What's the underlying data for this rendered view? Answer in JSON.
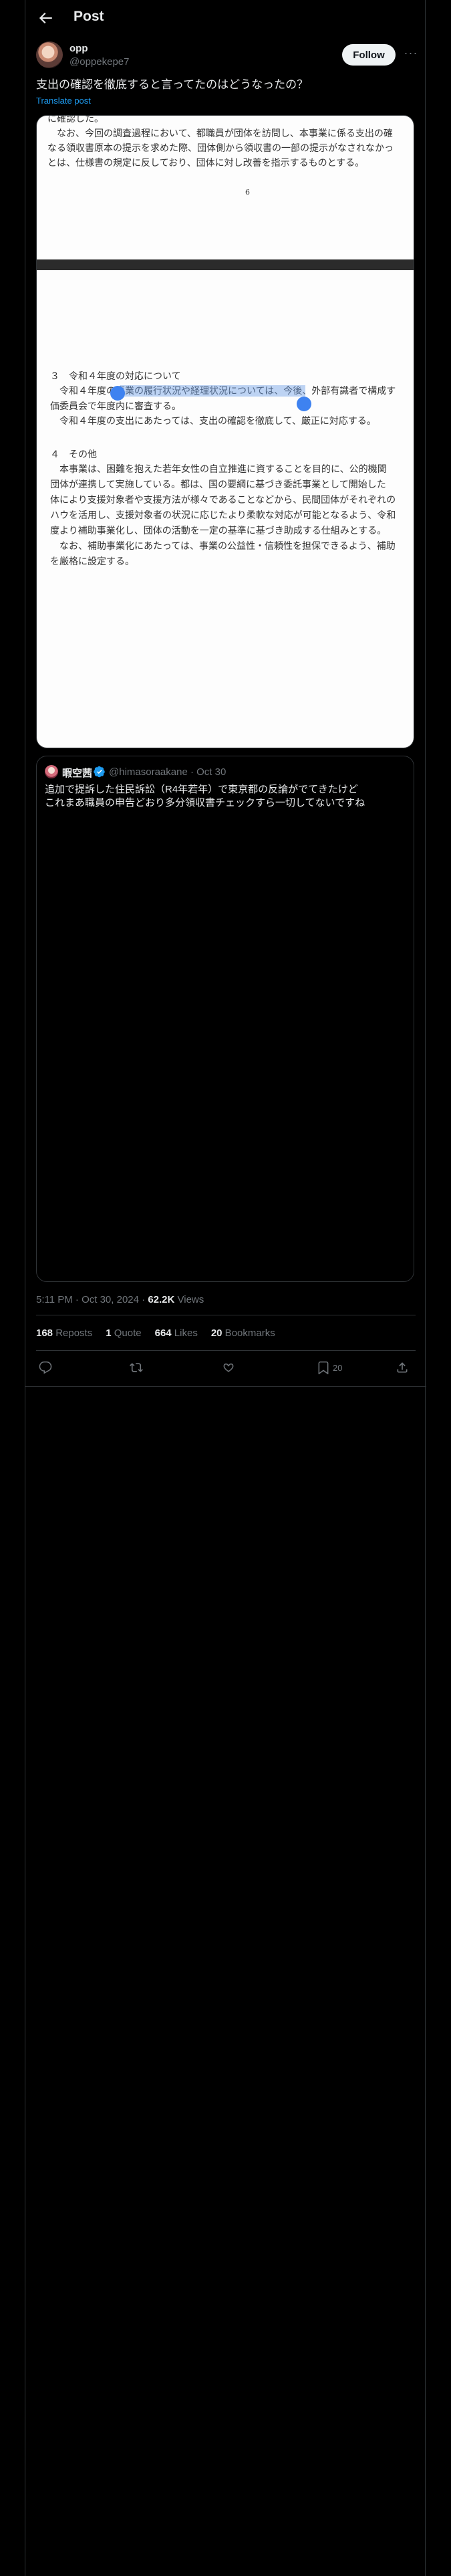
{
  "header": {
    "title": "Post"
  },
  "post": {
    "display_name": "opp",
    "handle": "@oppekepe7",
    "follow_label": "Follow",
    "more_label": "···",
    "text": "支出の確認を徹底すると言ってたのはどうなったの？",
    "translate_label": "Translate post"
  },
  "document": {
    "page1_lines": [
      "に確認した。",
      "　なお、今回の調査過程において、都職員が団体を訪問し、本事業に係る支出の確",
      "なる領収書原本の提示を求めた際、団体側から領収書の一部の提示がなされなかっ",
      "とは、仕様書の規定に反しており、団体に対し改善を指示するものとする。"
    ],
    "page_number": "6",
    "page2_lines": [
      "３　令和４年度の対応について",
      "　令和４年度の事業の履行状況や経理状況については、今後、外部有識者で構成す",
      "価委員会で年度内に審査する。",
      "　令和４年度の支出にあたっては、支出の確認を徹底して、厳正に対応する。",
      "",
      "４　その他",
      "　本事業は、困難を抱えた若年女性の自立推進に資することを目的に、公的機関",
      "団体が連携して実施している。都は、国の要綱に基づき委託事業として開始した",
      "体により支援対象者や支援方法が様々であることなどから、民間団体がそれぞれの",
      "ハウを活用し、支援対象者の状況に応じたより柔軟な対応が可能となるよう、令和",
      "度より補助事業化し、団体の活動を一定の基準に基づき助成する仕組みとする。",
      "　なお、補助事業化にあたっては、事業の公益性・信頼性を担保できるよう、補助",
      "を厳格に設定する。"
    ]
  },
  "quote": {
    "display_name": "暇空茜",
    "handle": "@himasoraakane",
    "separator": "·",
    "date": "Oct 30",
    "line1": "追加で提訴した住民訴訟（R4年若年）で東京都の反論がでてきたけど",
    "line2": "これまあ職員の申告どおり多分領収書チェックすら一切してないですね"
  },
  "meta": {
    "time": "5:11 PM · Oct 30, 2024 · ",
    "views_count": "62.2K",
    "views_label": " Views"
  },
  "stats": {
    "reposts_count": "168",
    "reposts_label": " Reposts",
    "quotes_count": "1",
    "quotes_label": " Quote",
    "likes_count": "664",
    "likes_label": " Likes",
    "bookmarks_count": "20",
    "bookmarks_label": " Bookmarks"
  },
  "actions": {
    "bookmark_count": "20"
  }
}
